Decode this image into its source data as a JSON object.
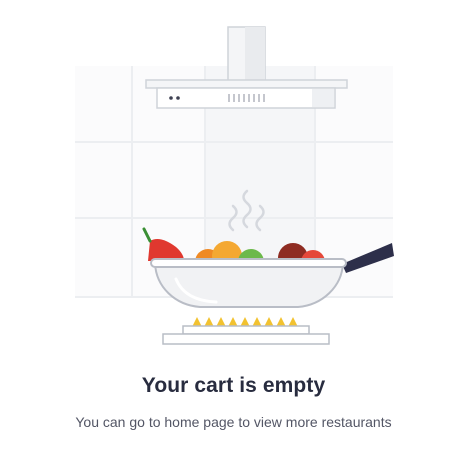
{
  "empty_state": {
    "title": "Your cart is empty",
    "subtitle": "You can go to home page to view more restaurants",
    "illustration_icon": "cooking-pan-on-stove-icon"
  },
  "colors": {
    "title_text": "#282c3f",
    "subtitle_text": "#535665",
    "tile_grout": "#eceef1",
    "flame": "#f2c230",
    "pan_handle": "#2d2f4a",
    "chili": "#e0382f",
    "orange": "#f4a832",
    "tomato": "#e5483a",
    "lime": "#6cb94b",
    "onion": "#8e2c22"
  }
}
